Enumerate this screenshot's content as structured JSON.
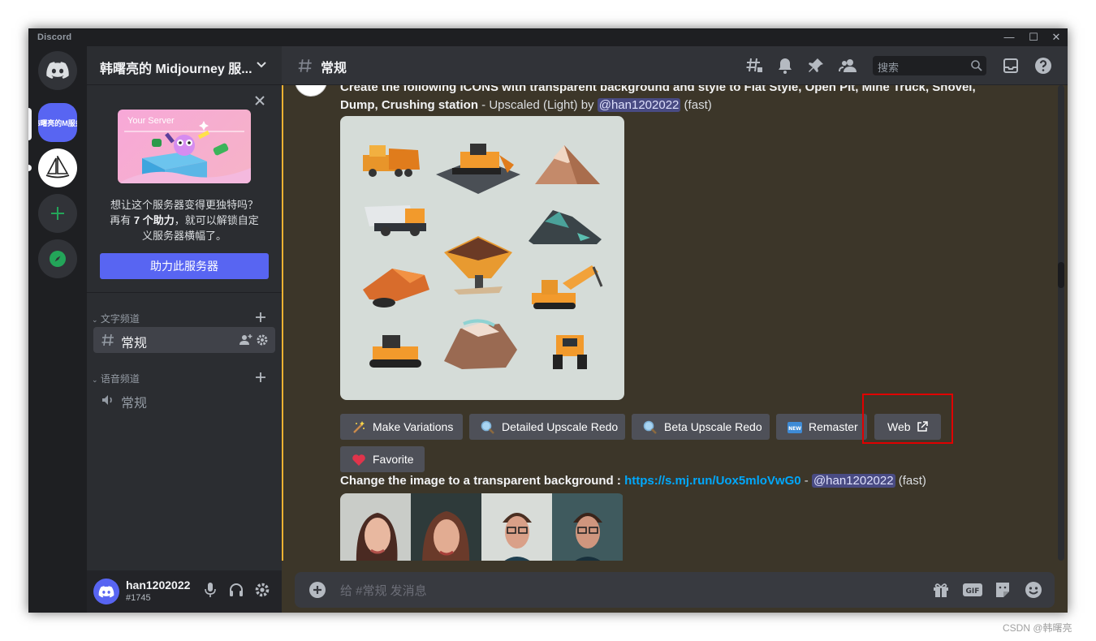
{
  "app": {
    "wordmark": "Discord"
  },
  "window_controls": {
    "minimize": "—",
    "maximize": "☐",
    "close": "✕"
  },
  "servers": {
    "current_label": "韩曙亮的M服务"
  },
  "guild": {
    "name": "韩曙亮的 Midjourney 服...",
    "boost": {
      "art_tag": "Your Server",
      "line1": "想让这个服务器变得更独特吗？",
      "line2_prefix": "再有 ",
      "line2_bold": "7 个助力",
      "line2_suffix": "，就可以解锁自定",
      "line3": "义服务器横幅了。",
      "button": "助力此服务器"
    },
    "categories": [
      {
        "label": "文字频道",
        "channels": [
          {
            "name": "常规",
            "type": "text",
            "selected": true
          }
        ]
      },
      {
        "label": "语音频道",
        "channels": [
          {
            "name": "常规",
            "type": "voice",
            "selected": false
          }
        ]
      }
    ]
  },
  "user": {
    "name": "han1202022",
    "tag": "#1745"
  },
  "channel": {
    "title": "常规",
    "search_placeholder": "搜索"
  },
  "messages": {
    "first": {
      "line1": "Create the following ICONS with transparent background and style to Flat Style, Open Pit, Mine Truck, Shovel,",
      "line2_bold": "Dump, Crushing station",
      "line2_mid": " - Upscaled (Light) by ",
      "mention": "@han1202022",
      "speed": " (fast)"
    },
    "buttons": [
      {
        "label": "Make Variations",
        "emoji": "magic-wand"
      },
      {
        "label": "Detailed Upscale Redo",
        "emoji": "magnifier"
      },
      {
        "label": "Beta Upscale Redo",
        "emoji": "magnifier"
      },
      {
        "label": "Remaster",
        "emoji": "new-badge"
      },
      {
        "label": "Web",
        "emoji": "external-link"
      },
      {
        "label": "Favorite",
        "emoji": "heart"
      }
    ],
    "second": {
      "bold": "Change the image to a transparent background : ",
      "link": "https://s.mj.run/Uox5mloVwG0",
      "sep": " - ",
      "mention": "@han1202022",
      "speed": " (fast)"
    }
  },
  "composer": {
    "placeholder": "给 #常规 发消息"
  },
  "watermark": "CSDN @韩曙亮",
  "colors": {
    "accent": "#5865f2",
    "highlight_box": "#e00000",
    "mention_bar": "#f0b232"
  }
}
